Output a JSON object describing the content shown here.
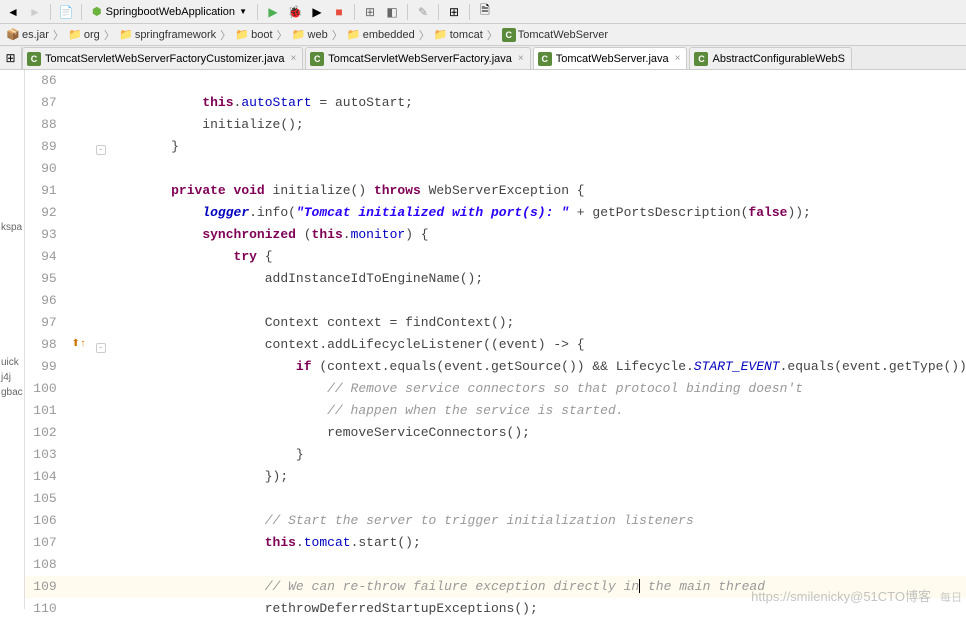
{
  "toolbar": {
    "run_config": "SpringbootWebApplication"
  },
  "breadcrumbs": [
    {
      "type": "jar",
      "label": "es.jar"
    },
    {
      "type": "folder",
      "label": "org"
    },
    {
      "type": "folder",
      "label": "springframework"
    },
    {
      "type": "folder",
      "label": "boot"
    },
    {
      "type": "folder",
      "label": "web"
    },
    {
      "type": "folder",
      "label": "embedded"
    },
    {
      "type": "folder",
      "label": "tomcat"
    },
    {
      "type": "class",
      "label": "TomcatWebServer"
    }
  ],
  "tabs": [
    {
      "label": "TomcatServletWebServerFactoryCustomizer.java",
      "icon": "C",
      "active": false
    },
    {
      "label": "TomcatServletWebServerFactory.java",
      "icon": "C",
      "active": false
    },
    {
      "label": "TomcatWebServer.java",
      "icon": "C",
      "active": true
    },
    {
      "label": "AbstractConfigurableWebS",
      "icon": "C",
      "active": false,
      "noclose": true
    }
  ],
  "left_panel": {
    "items": [
      "uick",
      "j4j",
      "gbac",
      "kspa"
    ]
  },
  "code_lines": [
    {
      "num": 86,
      "indent": 12,
      "segs": []
    },
    {
      "num": 87,
      "indent": 12,
      "segs": [
        {
          "t": "kw",
          "v": "this"
        },
        {
          "t": "p",
          "v": "."
        },
        {
          "t": "field",
          "v": "autoStart"
        },
        {
          "t": "p",
          "v": " = autoStart;"
        }
      ]
    },
    {
      "num": 88,
      "indent": 12,
      "segs": [
        {
          "t": "p",
          "v": "initialize();"
        }
      ]
    },
    {
      "num": 89,
      "indent": 8,
      "segs": [
        {
          "t": "p",
          "v": "}"
        }
      ],
      "fold": "end"
    },
    {
      "num": 90,
      "indent": 0,
      "segs": []
    },
    {
      "num": 91,
      "indent": 8,
      "segs": [
        {
          "t": "kw",
          "v": "private void"
        },
        {
          "t": "p",
          "v": " initialize() "
        },
        {
          "t": "kw",
          "v": "throws"
        },
        {
          "t": "p",
          "v": " WebServerException {"
        }
      ]
    },
    {
      "num": 92,
      "indent": 12,
      "segs": [
        {
          "t": "static",
          "v": "logger"
        },
        {
          "t": "p",
          "v": ".info("
        },
        {
          "t": "str",
          "v": "\"Tomcat initialized with port(s): \""
        },
        {
          "t": "p",
          "v": " + getPortsDescription("
        },
        {
          "t": "kw",
          "v": "false"
        },
        {
          "t": "p",
          "v": "));"
        }
      ]
    },
    {
      "num": 93,
      "indent": 12,
      "segs": [
        {
          "t": "kw",
          "v": "synchronized"
        },
        {
          "t": "p",
          "v": " ("
        },
        {
          "t": "kw",
          "v": "this"
        },
        {
          "t": "p",
          "v": "."
        },
        {
          "t": "field",
          "v": "monitor"
        },
        {
          "t": "p",
          "v": ") {"
        }
      ]
    },
    {
      "num": 94,
      "indent": 16,
      "segs": [
        {
          "t": "kw",
          "v": "try"
        },
        {
          "t": "p",
          "v": " {"
        }
      ]
    },
    {
      "num": 95,
      "indent": 20,
      "segs": [
        {
          "t": "p",
          "v": "addInstanceIdToEngineName();"
        }
      ]
    },
    {
      "num": 96,
      "indent": 0,
      "segs": []
    },
    {
      "num": 97,
      "indent": 20,
      "segs": [
        {
          "t": "p",
          "v": "Context context = findContext();"
        }
      ]
    },
    {
      "num": 98,
      "indent": 20,
      "segs": [
        {
          "t": "p",
          "v": "context.addLifecycleListener((event) -> {"
        }
      ],
      "icon": "impl"
    },
    {
      "num": 99,
      "indent": 24,
      "segs": [
        {
          "t": "kw",
          "v": "if"
        },
        {
          "t": "p",
          "v": " (context.equals(event.getSource()) && Lifecycle."
        },
        {
          "t": "const",
          "v": "START_EVENT"
        },
        {
          "t": "p",
          "v": ".equals(event.getType())) {"
        }
      ]
    },
    {
      "num": 100,
      "indent": 28,
      "segs": [
        {
          "t": "cmt",
          "v": "// Remove service connectors so that protocol binding doesn't"
        }
      ]
    },
    {
      "num": 101,
      "indent": 28,
      "segs": [
        {
          "t": "cmt",
          "v": "// happen when the service is started."
        }
      ]
    },
    {
      "num": 102,
      "indent": 28,
      "segs": [
        {
          "t": "p",
          "v": "removeServiceConnectors();"
        }
      ]
    },
    {
      "num": 103,
      "indent": 24,
      "segs": [
        {
          "t": "p",
          "v": "}"
        }
      ]
    },
    {
      "num": 104,
      "indent": 20,
      "segs": [
        {
          "t": "p",
          "v": "});"
        }
      ]
    },
    {
      "num": 105,
      "indent": 0,
      "segs": []
    },
    {
      "num": 106,
      "indent": 20,
      "segs": [
        {
          "t": "cmt",
          "v": "// Start the server to trigger initialization listeners"
        }
      ]
    },
    {
      "num": 107,
      "indent": 20,
      "segs": [
        {
          "t": "kw",
          "v": "this"
        },
        {
          "t": "p",
          "v": "."
        },
        {
          "t": "field",
          "v": "tomcat"
        },
        {
          "t": "p",
          "v": ".start();"
        }
      ]
    },
    {
      "num": 108,
      "indent": 0,
      "segs": []
    },
    {
      "num": 109,
      "indent": 20,
      "highlight": true,
      "cursor_after": "// We can re-throw failure exception directly in",
      "cursor_tail": " the main thread",
      "segs": []
    },
    {
      "num": 110,
      "indent": 20,
      "segs": [
        {
          "t": "p",
          "v": "rethrowDeferredStartupExceptions();"
        }
      ]
    }
  ],
  "watermark": "https://smilenicky@51CTO博客",
  "watermark2": "每日"
}
